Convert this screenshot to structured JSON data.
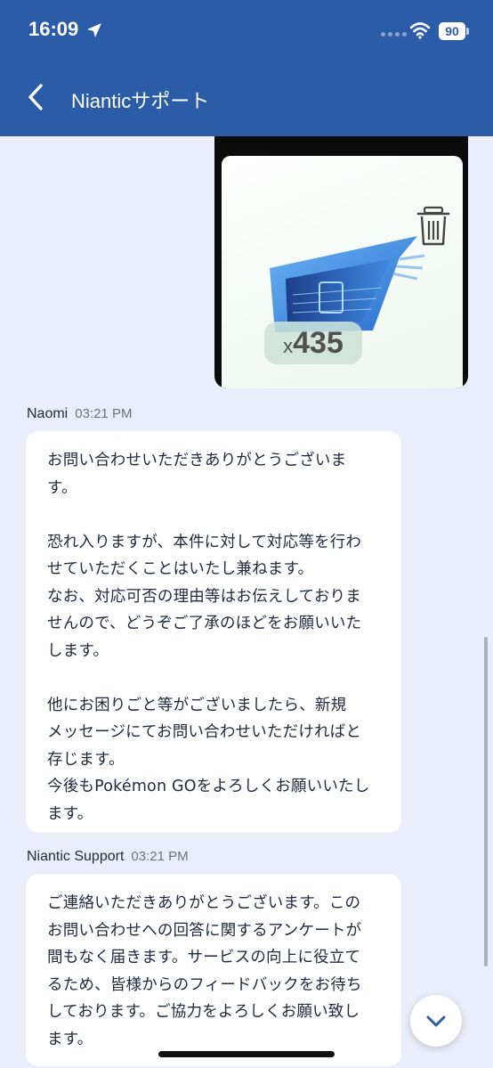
{
  "status_bar": {
    "time": "16:09",
    "battery": "90",
    "icons": [
      "location-arrow-icon",
      "signal-dots-icon",
      "wifi-icon",
      "battery-icon"
    ]
  },
  "header": {
    "title": "Nianticサポート",
    "back_icon": "chevron-left-icon",
    "background": "#2a5ca8"
  },
  "attachment": {
    "item_count_prefix": "x",
    "item_count": "435",
    "icons": [
      "trash-icon"
    ]
  },
  "messages": [
    {
      "sender": "Naomi",
      "time": "03:21 PM",
      "text": "お問い合わせいただきありがとうございま\nす。\n\n恐れ入りますが、本件に対して対応等を行わ\nせていただくことはいたし兼ねます。\nなお、対応可否の理由等はお伝えしておりま\nせんので、どうぞご了承のほどをお願いいた\nします。\n\n他にお困りごと等がございましたら、新規\nメッセージにてお問い合わせいただければと\n存じます。\n今後もPokémon GOをよろしくお願いいたし\nます。"
    },
    {
      "sender": "Niantic Support",
      "time": "03:21 PM",
      "text": "ご連絡いただきありがとうございます。この\nお問い合わせへの回答に関するアンケートが\n間もなく届きます。サービスの向上に役立て\nるため、皆様からのフィードバックをお待ち\nしております。ご協力をよろしくお願い致し\nます。"
    }
  ],
  "scroll_button_icon": "chevron-down-icon",
  "colors": {
    "background": "#e9eefa",
    "bubble": "#ffffff",
    "accent": "#2a5ca8"
  }
}
